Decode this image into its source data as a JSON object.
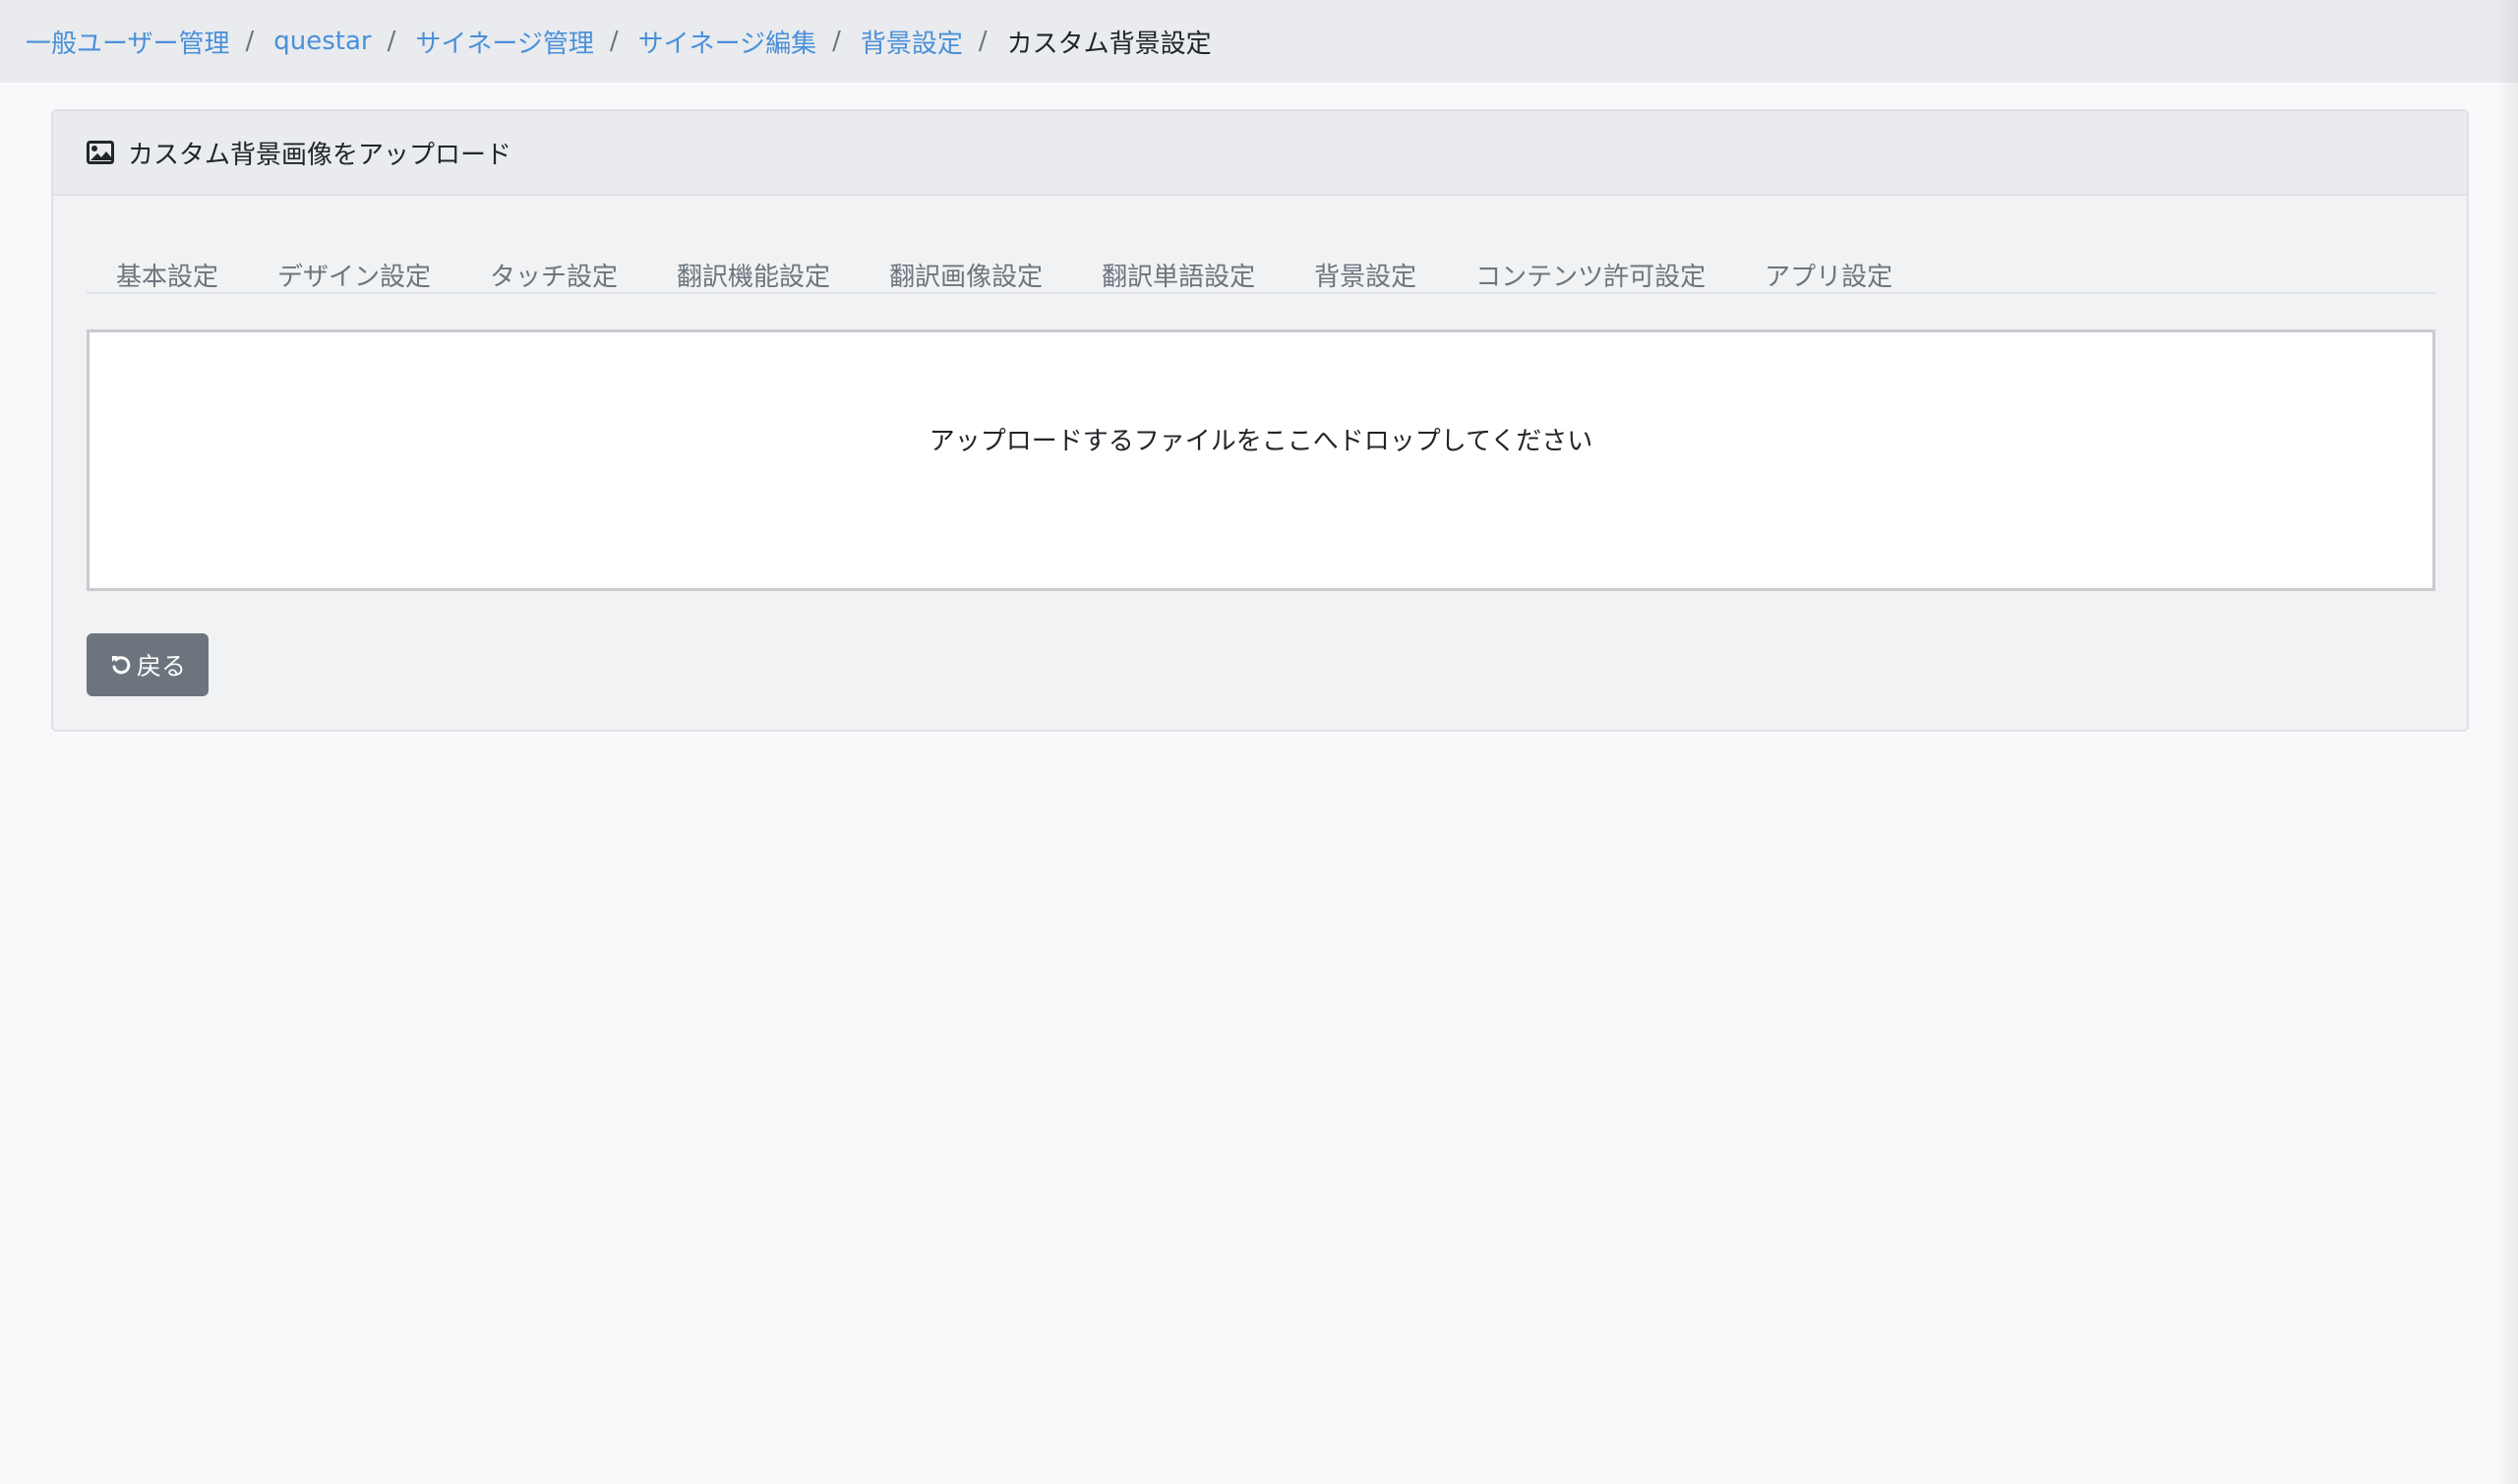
{
  "breadcrumb": {
    "items": [
      {
        "label": "一般ユーザー管理"
      },
      {
        "label": "questar"
      },
      {
        "label": "サイネージ管理"
      },
      {
        "label": "サイネージ編集"
      },
      {
        "label": "背景設定"
      }
    ],
    "separator": "/",
    "current": "カスタム背景設定"
  },
  "card": {
    "icon": "image-icon",
    "title": "カスタム背景画像をアップロード"
  },
  "tabs": [
    {
      "label": "基本設定"
    },
    {
      "label": "デザイン設定"
    },
    {
      "label": "タッチ設定"
    },
    {
      "label": "翻訳機能設定"
    },
    {
      "label": "翻訳画像設定"
    },
    {
      "label": "翻訳単語設定"
    },
    {
      "label": "背景設定"
    },
    {
      "label": "コンテンツ許可設定"
    },
    {
      "label": "アプリ設定"
    }
  ],
  "dropzone": {
    "message": "アップロードするファイルをここへドロップしてください"
  },
  "back_button": {
    "icon": "undo-icon",
    "label": "戻る"
  },
  "colors": {
    "link": "#4a90d9",
    "secondary_button": "#6c757d",
    "header_bg": "#e9ebee"
  }
}
